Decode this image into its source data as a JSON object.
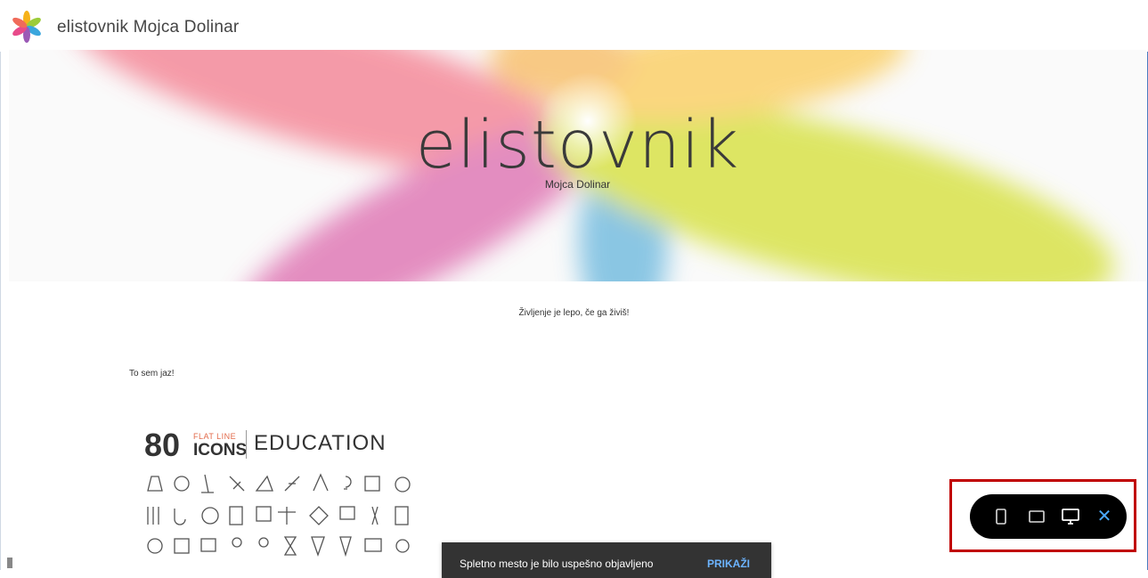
{
  "header": {
    "site_name": "elistovnik Mojca Dolinar",
    "logo_icon": "pinwheel-logo-icon"
  },
  "hero": {
    "title": "elistovnik",
    "subtitle": "Mojca Dolinar"
  },
  "content": {
    "tagline": "Življenje je lepo, če ga živiš!",
    "intro": "To sem jaz!",
    "image": {
      "number": "80",
      "flat_line": "FLAT LINE",
      "icons": "ICONS",
      "education": "EDUCATION"
    }
  },
  "toast": {
    "message": "Spletno mesto je bilo uspešno objavljeno",
    "action": "PRIKAŽI"
  },
  "device_toolbar": {
    "buttons": [
      "phone-icon",
      "tablet-icon",
      "desktop-icon",
      "close-icon"
    ],
    "close_symbol": "✕",
    "accent_color": "#4aa8ff",
    "highlight_color": "#c00000"
  }
}
